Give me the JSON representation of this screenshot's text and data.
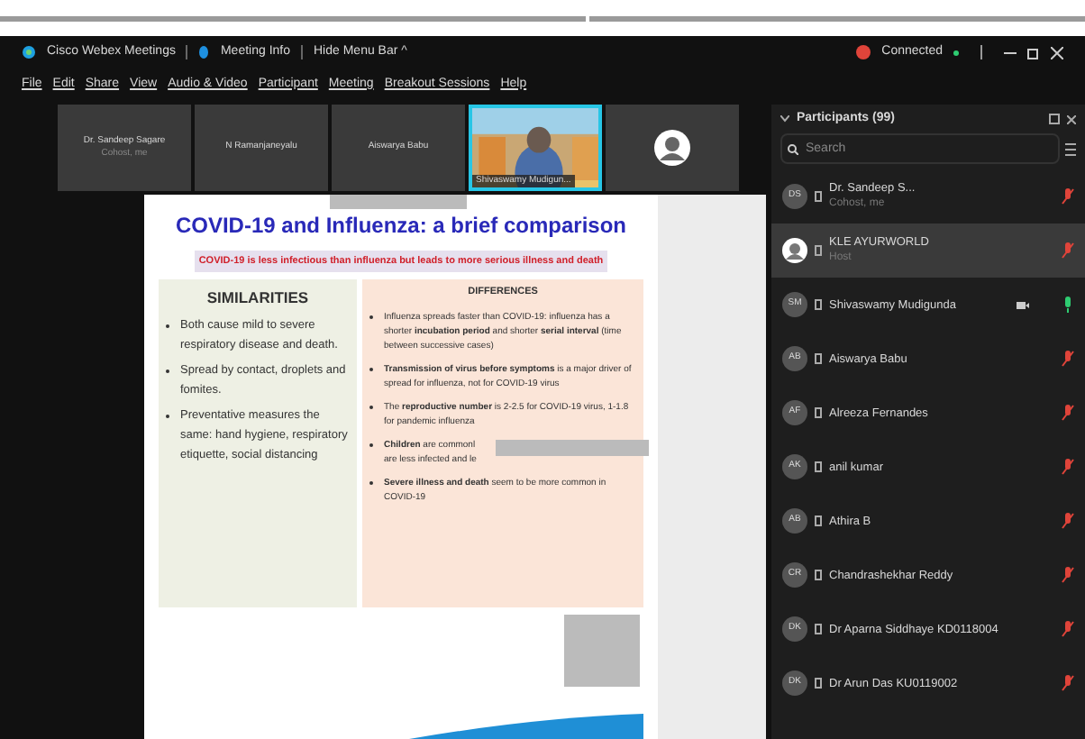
{
  "window": {
    "title": "Cisco Webex Meetings",
    "meeting_info": "Meeting Info",
    "hide_menu": "Hide Menu Bar ^",
    "status": "Connected"
  },
  "menu": [
    "File",
    "Edit",
    "Share",
    "View",
    "Audio & Video",
    "Participant",
    "Meeting",
    "Breakout Sessions",
    "Help"
  ],
  "videos": [
    {
      "kind": "name",
      "name": "Dr. Sandeep Sagare",
      "subtitle": "Cohost, me",
      "active": false
    },
    {
      "kind": "name",
      "name": "N Ramanjaneyalu",
      "active": false
    },
    {
      "kind": "name",
      "name": "Aiswarya Babu",
      "active": false
    },
    {
      "kind": "video",
      "name": "Shivaswamy Mudigun...",
      "active": true
    },
    {
      "kind": "avatar",
      "active": false
    }
  ],
  "slide": {
    "title": "COVID-19 and Influenza: a brief comparison",
    "banner": "COVID-19 is less infectious than influenza but leads to more serious illness and death",
    "similarities": {
      "heading": "SIMILARITIES",
      "items": [
        "Both cause mild to severe respiratory disease and death.",
        "Spread by contact, droplets and fomites.",
        "Preventative measures the same: hand hygiene, respiratory etiquette, social distancing"
      ]
    },
    "differences": {
      "heading": "DIFFERENCES",
      "items": [
        {
          "lines": [
            "Influenza spreads faster than COVID-19: influenza has a shorter **incubation period** and shorter **serial interval** (time between successive cases)"
          ]
        },
        {
          "lines": [
            "**Transmission of virus before symptoms** is a major driver of spread for influenza, not for COVID-19 virus"
          ]
        },
        {
          "lines": [
            "The **reproductive number** is 2-2.5 for COVID-19 virus, 1-1.8 for pandemic influenza"
          ]
        },
        {
          "lines": [
            "**Children** are commonl",
            "are less infected and le"
          ],
          "covered": true
        },
        {
          "lines": [
            "**Severe illness and death** seem to be more common in COVID-19"
          ]
        }
      ]
    }
  },
  "participants": {
    "title": "Participants (99)",
    "search": {
      "placeholder": "Search"
    },
    "items": [
      {
        "kind": "initials",
        "initials": "DS",
        "name": "Dr. Sandeep S...",
        "subtitle": "Cohost, me",
        "muted": true,
        "selected": false,
        "video": false
      },
      {
        "kind": "picture",
        "name": "KLE AYURWORLD",
        "subtitle": "Host",
        "muted": true,
        "selected": true,
        "video": false
      },
      {
        "kind": "initials",
        "initials": "SM",
        "name": "Shivaswamy Mudigunda",
        "muted": false,
        "selected": false,
        "video": true
      },
      {
        "kind": "initials",
        "initials": "AB",
        "name": "Aiswarya Babu",
        "muted": true,
        "selected": false,
        "video": false
      },
      {
        "kind": "initials",
        "initials": "AF",
        "name": "Alreeza Fernandes",
        "muted": true,
        "selected": false,
        "video": false
      },
      {
        "kind": "initials",
        "initials": "AK",
        "name": "anil kumar",
        "muted": true,
        "selected": false,
        "video": false
      },
      {
        "kind": "initials",
        "initials": "AB",
        "name": "Athira B",
        "muted": true,
        "selected": false,
        "video": false
      },
      {
        "kind": "initials",
        "initials": "CR",
        "name": "Chandrashekhar Reddy",
        "muted": true,
        "selected": false,
        "video": false
      },
      {
        "kind": "initials",
        "initials": "DK",
        "name": "Dr Aparna Siddhaye KD0118004",
        "muted": true,
        "selected": false,
        "video": false
      },
      {
        "kind": "initials",
        "initials": "DK",
        "name": "Dr Arun Das KU0119002",
        "muted": true,
        "selected": false,
        "video": false
      }
    ]
  }
}
